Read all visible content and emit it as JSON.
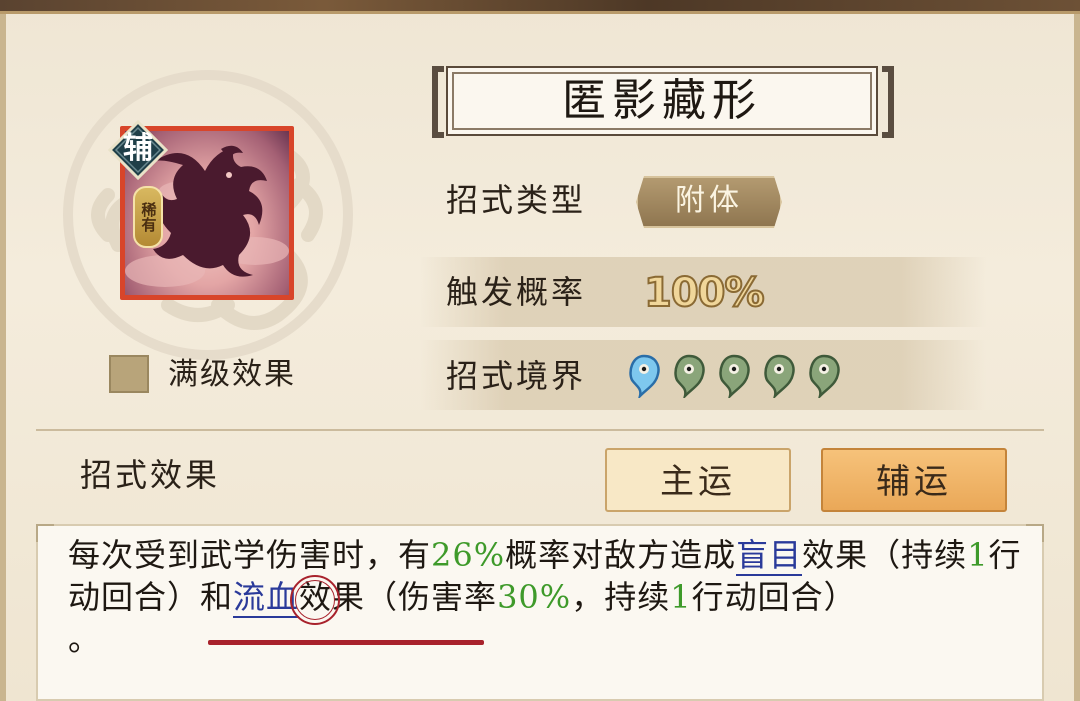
{
  "skill": {
    "name": "匿影藏形",
    "badge": "辅",
    "rarity": "稀有",
    "max_level_label": "满级效果",
    "max_level_checked": false
  },
  "stats": {
    "type_label": "招式类型",
    "type_value": "附体",
    "rate_label": "触发概率",
    "rate_value": "100%",
    "realm_label": "招式境界",
    "realm_level": 1,
    "realm_max": 5
  },
  "effect": {
    "title": "招式效果",
    "tabs": [
      {
        "label": "主运",
        "selected": false
      },
      {
        "label": "辅运",
        "selected": true
      }
    ],
    "text": {
      "p1": "每次受到武学伤害时，有",
      "chance": "26%",
      "p2": "概率对敌方造成",
      "status1": "盲目",
      "p3": "效果（持续",
      "dur1": "1",
      "p4": "行动回合）",
      "and": "和",
      "status2": "流血",
      "p5": "效果（伤害率",
      "dmg": "30%",
      "p6": "，持续",
      "dur2": "1",
      "p7": "行动回合）",
      "end": "。"
    }
  },
  "colors": {
    "accent_orange": "#eaa858",
    "number_green": "#3e9a2a",
    "link_blue": "#2a3a9a",
    "annotation_red": "#a8222c"
  },
  "icons": [
    "cloud-emblem-icon",
    "beast-silhouette-icon",
    "realm-drop-icon"
  ]
}
